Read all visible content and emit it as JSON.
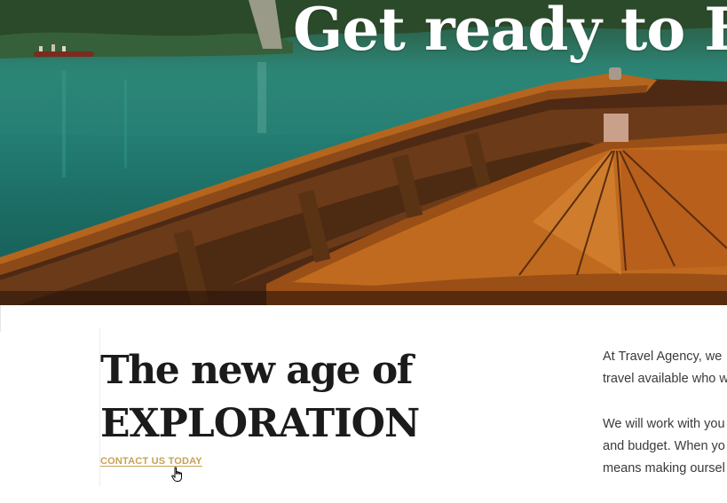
{
  "hero": {
    "title": "Get ready to Ex"
  },
  "intro": {
    "headline_line1": "The new age of",
    "headline_line2": "EXPLORATION",
    "cta_label": "CONTACT US TODAY"
  },
  "body": {
    "p1_line1": "At Travel Agency, we",
    "p1_line2": "travel available who w",
    "p2_line1": "We will work with you",
    "p2_line2": "and budget. When yo",
    "p2_line3": "means making oursel"
  },
  "colors": {
    "accent": "#c7a257",
    "heading": "#1b1b1b",
    "text": "#3a3a3a"
  },
  "icons": {
    "cursor": "hand-pointer-icon"
  }
}
